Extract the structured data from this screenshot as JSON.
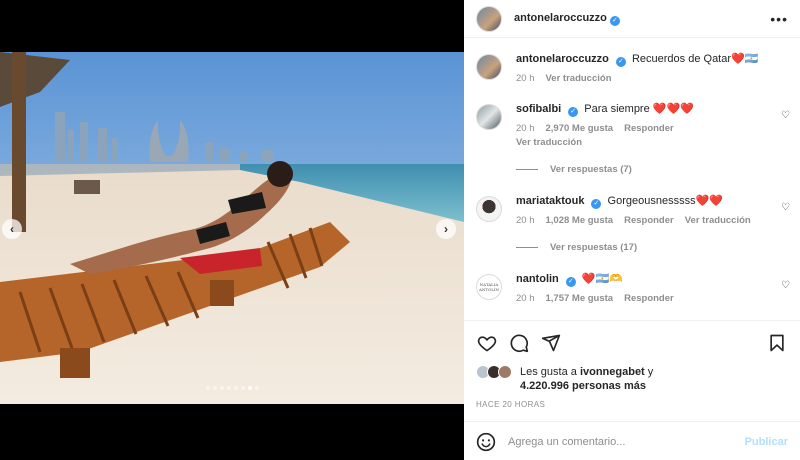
{
  "post": {
    "author": "antonelaroccuzzo",
    "caption": "Recuerdos de Qatar",
    "caption_emoji": "❤️🇦🇷",
    "caption_time": "20 h",
    "caption_translate": "Ver traducción",
    "carousel": {
      "total": 8,
      "active": 7
    }
  },
  "comments": [
    {
      "username": "sofibalbi",
      "text": "Para siempre",
      "emoji": "❤️❤️❤️",
      "time": "20 h",
      "likes": "2,970 Me gusta",
      "reply": "Responder",
      "translate": "Ver traducción",
      "replies": "Ver respuestas (7)"
    },
    {
      "username": "mariataktouk",
      "text": "Gorgeousnesssss",
      "emoji": "❤️❤️",
      "time": "20 h",
      "likes": "1,028 Me gusta",
      "reply": "Responder",
      "translate": "Ver traducción",
      "replies": "Ver respuestas (17)"
    },
    {
      "username": "nantolin",
      "text": "",
      "emoji": "❤️🇦🇷🫶",
      "time": "20 h",
      "likes": "1,757 Me gusta",
      "reply": "Responder",
      "avatar_text": "NATALIA ANTOLÍN"
    }
  ],
  "likes": {
    "prefix": "Les gusta a",
    "user": "ivonnegabet",
    "connector": "y",
    "others": "4.220.996 personas más"
  },
  "timestamp": "HACE 20 HORAS",
  "comment_box": {
    "placeholder": "Agrega un comentario...",
    "publish": "Publicar"
  },
  "icons": {
    "header": [
      "verified-badge",
      "more-options"
    ],
    "actions": [
      "heart",
      "comment",
      "share",
      "bookmark"
    ],
    "comment_box": [
      "emoji"
    ]
  },
  "colors": {
    "verified": "#3897f0",
    "publish_disabled": "#b2dffc",
    "heart_emoji": "#ed4956"
  }
}
